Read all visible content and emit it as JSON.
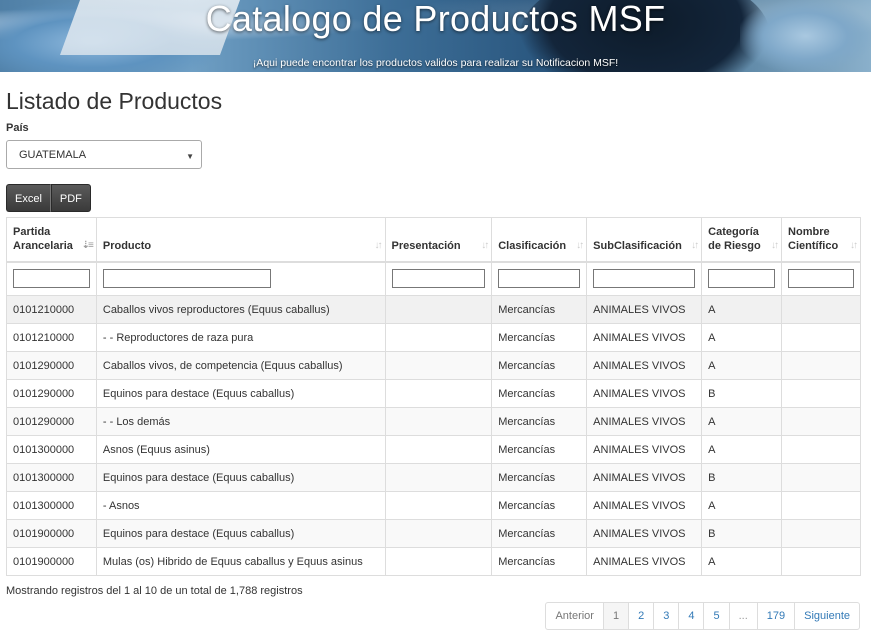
{
  "banner": {
    "title": "Catalogo de Productos MSF",
    "subtitle": "¡Aqui puede encontrar los productos validos para realizar su Notificacion MSF!"
  },
  "page": {
    "title": "Listado de Productos"
  },
  "filter": {
    "country_label": "País",
    "country_value": "GUATEMALA"
  },
  "export": {
    "excel_label": "Excel",
    "pdf_label": "PDF"
  },
  "table": {
    "headers": [
      {
        "line1": "Partida",
        "line2": "Arancelaria"
      },
      {
        "line1": "",
        "line2": "Producto"
      },
      {
        "line1": "",
        "line2": "Presentación"
      },
      {
        "line1": "",
        "line2": "Clasificación"
      },
      {
        "line1": "",
        "line2": "SubClasificación"
      },
      {
        "line1": "Categoría",
        "line2": "de Riesgo"
      },
      {
        "line1": "Nombre",
        "line2": "Científico"
      }
    ],
    "rows": [
      [
        "0101210000",
        "Caballos vivos reproductores (Equus caballus)",
        "",
        "Mercancías",
        "ANIMALES VIVOS",
        "A",
        ""
      ],
      [
        "0101210000",
        "- - Reproductores de raza pura",
        "",
        "Mercancías",
        "ANIMALES VIVOS",
        "A",
        ""
      ],
      [
        "0101290000",
        "Caballos vivos, de competencia (Equus caballus)",
        "",
        "Mercancías",
        "ANIMALES VIVOS",
        "A",
        ""
      ],
      [
        "0101290000",
        "Equinos para destace (Equus caballus)",
        "",
        "Mercancías",
        "ANIMALES VIVOS",
        "B",
        ""
      ],
      [
        "0101290000",
        "- - Los demás",
        "",
        "Mercancías",
        "ANIMALES VIVOS",
        "A",
        ""
      ],
      [
        "0101300000",
        "Asnos (Equus asinus)",
        "",
        "Mercancías",
        "ANIMALES VIVOS",
        "A",
        ""
      ],
      [
        "0101300000",
        "Equinos para destace (Equus caballus)",
        "",
        "Mercancías",
        "ANIMALES VIVOS",
        "B",
        ""
      ],
      [
        "0101300000",
        "- Asnos",
        "",
        "Mercancías",
        "ANIMALES VIVOS",
        "A",
        ""
      ],
      [
        "0101900000",
        "Equinos para destace (Equus caballus)",
        "",
        "Mercancías",
        "ANIMALES VIVOS",
        "B",
        ""
      ],
      [
        "0101900000",
        "Mulas (os) Hibrido de Equus caballus y Equus asinus",
        "",
        "Mercancías",
        "ANIMALES VIVOS",
        "A",
        ""
      ]
    ]
  },
  "info": {
    "text": "Mostrando registros del 1 al 10 de un total de 1,788 registros"
  },
  "pagination": {
    "previous": "Anterior",
    "pages": [
      "1",
      "2",
      "3",
      "4",
      "5"
    ],
    "ellipsis": "...",
    "last": "179",
    "next": "Siguiente"
  }
}
